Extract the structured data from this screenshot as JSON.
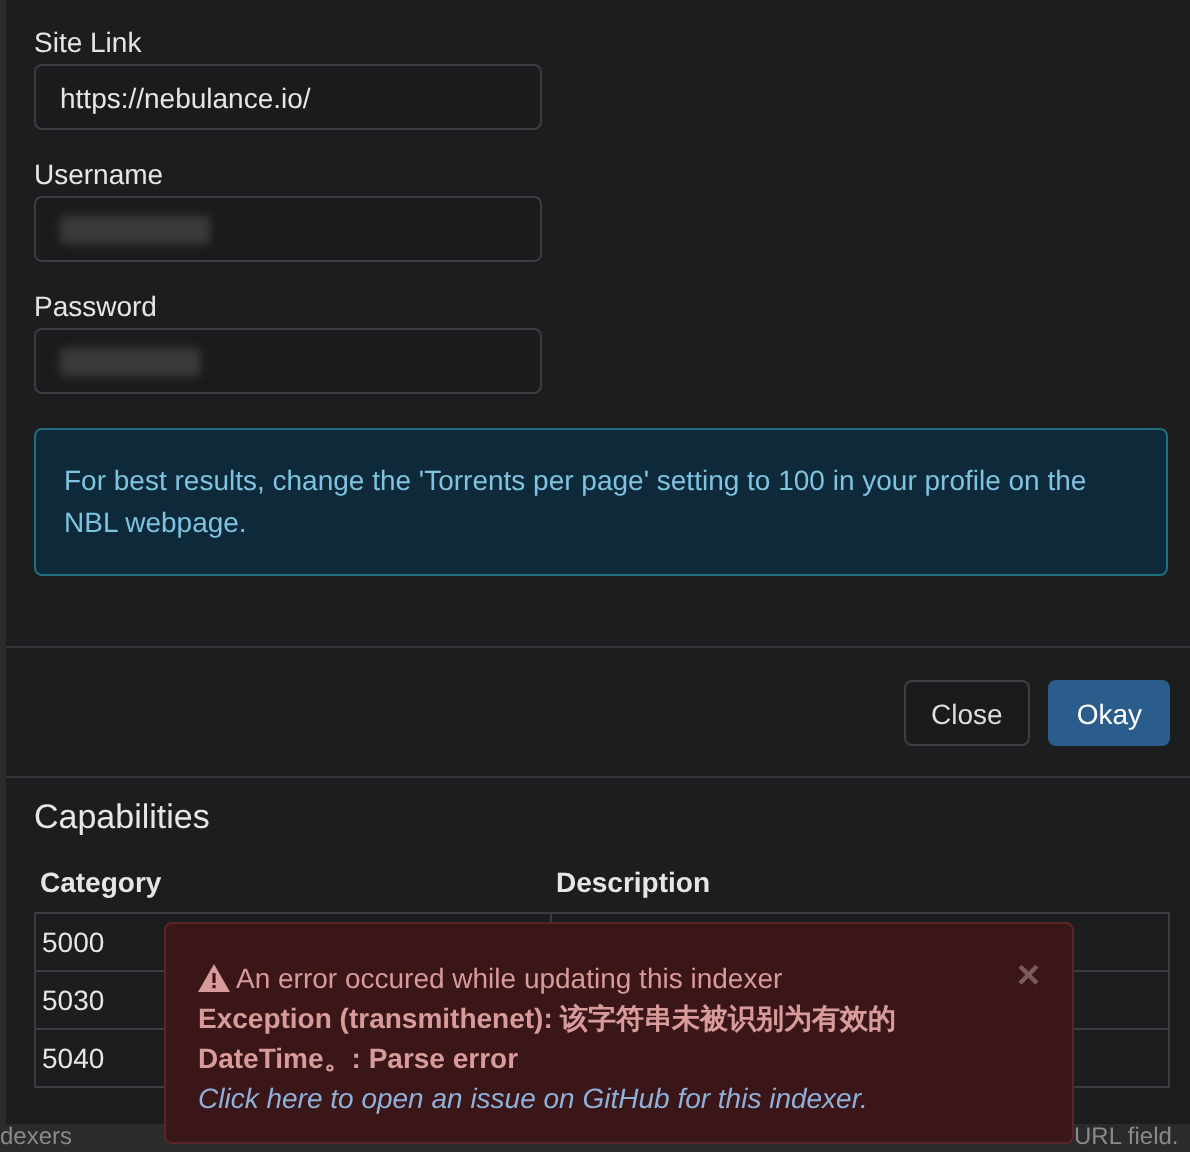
{
  "form": {
    "fields": [
      {
        "label": "Site Link",
        "value": "https://nebulance.io/",
        "kind": "text"
      },
      {
        "label": "Username",
        "kind": "hidden"
      },
      {
        "label": "Password",
        "kind": "hidden"
      }
    ],
    "info": "For best results, change the 'Torrents per page' setting to 100 in your profile on the NBL webpage."
  },
  "buttons": [
    {
      "label": "Close",
      "kind": "default"
    },
    {
      "label": "Okay",
      "kind": "primary"
    }
  ],
  "capabilities": {
    "title": "Capabilities",
    "columns": [
      "Category",
      "Description"
    ],
    "rows": [
      [
        "5000"
      ],
      [
        "5030"
      ],
      [
        "5040"
      ]
    ]
  },
  "toast": {
    "title": "An error occured while updating this indexer",
    "message": "Exception (transmithenet): 该字符串未被识别为有效的DateTime。: Parse error",
    "link": "Click here to open an issue on GitHub for this indexer.",
    "close": "×"
  },
  "background_text": [
    "dexers",
    "URL field."
  ]
}
